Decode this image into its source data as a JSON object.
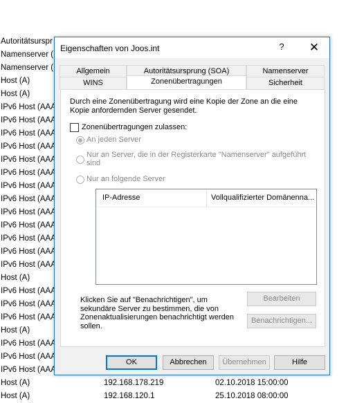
{
  "background_rows": [
    {
      "type": "Autoritätsurspr",
      "ip": "",
      "date": ""
    },
    {
      "type": "Namenserver (",
      "ip": "",
      "date": ""
    },
    {
      "type": "Namenserver (",
      "ip": "",
      "date": ""
    },
    {
      "type": "Host (A)",
      "ip": "",
      "date": ""
    },
    {
      "type": "Host (A)",
      "ip": "",
      "date": ""
    },
    {
      "type": "IPv6 Host (AAA",
      "ip": "",
      "date": ""
    },
    {
      "type": "IPv6 Host (AAA",
      "ip": "",
      "date": ""
    },
    {
      "type": "IPv6 Host (AAA",
      "ip": "",
      "date": ""
    },
    {
      "type": "IPv6 Host (AAA",
      "ip": "",
      "date": ""
    },
    {
      "type": "IPv6 Host (AAA",
      "ip": "",
      "date": ""
    },
    {
      "type": "IPv6 Host (AAA",
      "ip": "",
      "date": ""
    },
    {
      "type": "IPv6 Host (AAA",
      "ip": "",
      "date": ""
    },
    {
      "type": "IPv6 Host (AAA",
      "ip": "",
      "date": ""
    },
    {
      "type": "IPv6 Host (AAA",
      "ip": "",
      "date": ""
    },
    {
      "type": "IPv6 Host (AAA",
      "ip": "",
      "date": ""
    },
    {
      "type": "IPv6 Host (AAA",
      "ip": "",
      "date": ""
    },
    {
      "type": "IPv6 Host (AAA",
      "ip": "",
      "date": ""
    },
    {
      "type": "IPv6 Host (AAA",
      "ip": "",
      "date": ""
    },
    {
      "type": "Host (A)",
      "ip": "",
      "date": ""
    },
    {
      "type": "IPv6 Host (AAA",
      "ip": "",
      "date": ""
    },
    {
      "type": "IPv6 Host (AAA",
      "ip": "",
      "date": ""
    },
    {
      "type": "IPv6 Host (AAA",
      "ip": "",
      "date": ""
    },
    {
      "type": "Host (A)",
      "ip": "",
      "date": ""
    },
    {
      "type": "IPv6 Host (AAA",
      "ip": "",
      "date": ""
    },
    {
      "type": "IPv6 Host (AAA",
      "ip": "",
      "date": ""
    },
    {
      "type": "IPv6 Host (AAA",
      "ip": "",
      "date": ""
    },
    {
      "type": "Host (A)",
      "ip": "192.168.178.219",
      "date": "02.10.2018 15:00:00"
    },
    {
      "type": "Host (A)",
      "ip": "192.168.120.1",
      "date": "25.10.2018 08:00:00"
    }
  ],
  "dialog": {
    "title": "Eigenschaften von Joos.int",
    "help_label": "?",
    "close_label": "✕",
    "tabs_row1": [
      "Allgemein",
      "Autoritätsursprung (SOA)",
      "Namenserver"
    ],
    "tabs_row2": [
      "WINS",
      "Zonenübertragungen",
      "Sicherheit"
    ],
    "description": "Durch eine Zonenübertragung wird eine Kopie der Zone an die eine Kopie anfordernden Server gesendet.",
    "allow_transfers_label": "Zonenübertragungen zulassen:",
    "radio_any": "An jeden Server",
    "radio_nameservers": "Nur an Server, die in der Registerkarte \"Namenserver\" aufgeführt sind",
    "radio_following": "Nur an folgende Server",
    "list_columns": [
      "IP-Adresse",
      "Vollqualifizierter Domänenna..."
    ],
    "notify_note": "Klicken Sie auf \"Benachrichtigen\", um sekundäre Server zu bestimmen, die von Zonenaktualisierungen benachrichtigt werden sollen.",
    "edit_button": "Bearbeiten",
    "notify_button": "Benachrichtigen...",
    "ok_button": "OK",
    "cancel_button": "Abbrechen",
    "apply_button": "Übernehmen",
    "help_button": "Hilfe"
  }
}
